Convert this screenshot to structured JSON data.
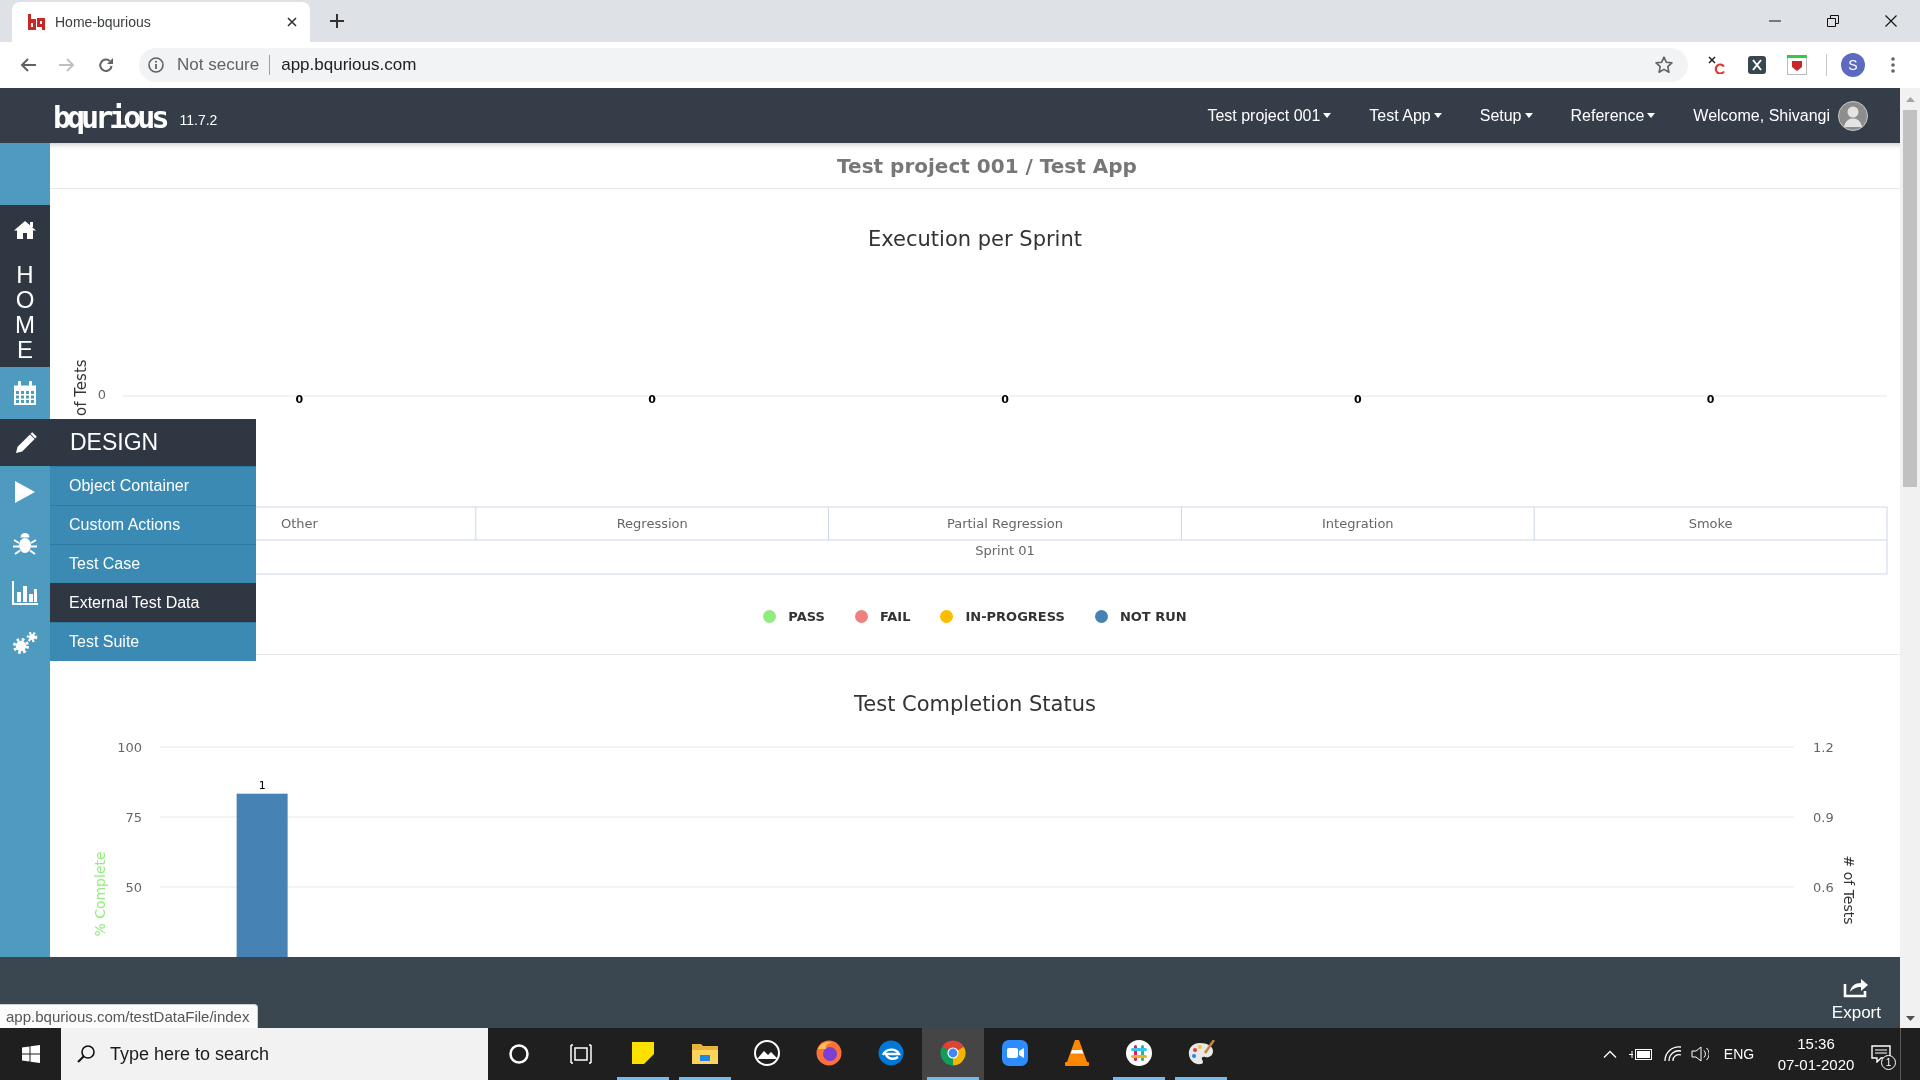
{
  "browser": {
    "tab": {
      "title": "Home-bqurious"
    },
    "address": {
      "security": "Not secure",
      "url": "app.bqurious.com"
    },
    "profile": "S"
  },
  "navbar": {
    "logo": "bqurious",
    "version": "11.7.2",
    "menus": [
      "Test project 001",
      "Test App",
      "Setup",
      "Reference"
    ],
    "welcome": "Welcome, Shivangi"
  },
  "sidebar": {
    "items": [
      {
        "label": "HOME",
        "selected": true
      },
      {
        "selected": false
      },
      {
        "label": "DESIGN",
        "selected": false,
        "expanded": true,
        "children": [
          {
            "label": "Object Container",
            "selected": false
          },
          {
            "label": "Custom Actions",
            "selected": false
          },
          {
            "label": "Test Case",
            "selected": false
          },
          {
            "label": "External Test Data",
            "selected": true
          },
          {
            "label": "Test Suite",
            "selected": false
          }
        ]
      },
      {
        "selected": false
      },
      {
        "selected": false
      },
      {
        "selected": false
      },
      {
        "selected": false
      }
    ]
  },
  "header": {
    "title": "Test project 001 / Test App"
  },
  "execution_chart": {
    "title": "Execution per Sprint",
    "y_axis_title": "of Tests",
    "y_tick": "0",
    "value_labels": [
      "0",
      "0",
      "0",
      "0",
      "0"
    ],
    "categories": [
      "Other",
      "Regression",
      "Partial Regression",
      "Integration",
      "Smoke"
    ],
    "group_label": "Sprint 01",
    "legend": [
      {
        "name": "PASS",
        "color": "#90ed7d"
      },
      {
        "name": "FAIL",
        "color": "#f08080"
      },
      {
        "name": "IN-PROGRESS",
        "color": "#ffbb00"
      },
      {
        "name": "NOT RUN",
        "color": "#4682b4"
      }
    ]
  },
  "completion_chart": {
    "chart_data": {
      "type": "bar",
      "title": "Test Completion Status",
      "ylabel": "# of Tests",
      "yticks": [
        0.6,
        0.9,
        1.2
      ],
      "ylim": [
        0.3,
        1.2
      ],
      "y2label": "% Complete",
      "y2ticks": [
        50,
        75,
        100
      ],
      "y2lim": [
        25,
        100
      ],
      "data_labels": true,
      "series": [
        {
          "color": "#4682b4",
          "values": [
            1
          ]
        }
      ]
    }
  },
  "footer": {
    "export": "Export"
  },
  "status_link": "app.bqurious.com/testDataFile/index",
  "taskbar": {
    "search": {
      "placeholder": "Type here to search"
    },
    "apps": [
      {
        "running": true,
        "active": false
      },
      {
        "running": true,
        "active": false
      },
      {
        "running": false,
        "active": false
      },
      {
        "running": false,
        "active": false
      },
      {
        "running": false,
        "active": false
      },
      {
        "running": true,
        "active": true
      },
      {
        "running": false,
        "active": false
      },
      {
        "running": false,
        "active": false
      },
      {
        "running": true,
        "active": false
      },
      {
        "running": true,
        "active": false
      }
    ],
    "tray": {
      "language": "ENG",
      "time": "15:36",
      "date": "07-01-2020",
      "notifications": "1"
    }
  }
}
